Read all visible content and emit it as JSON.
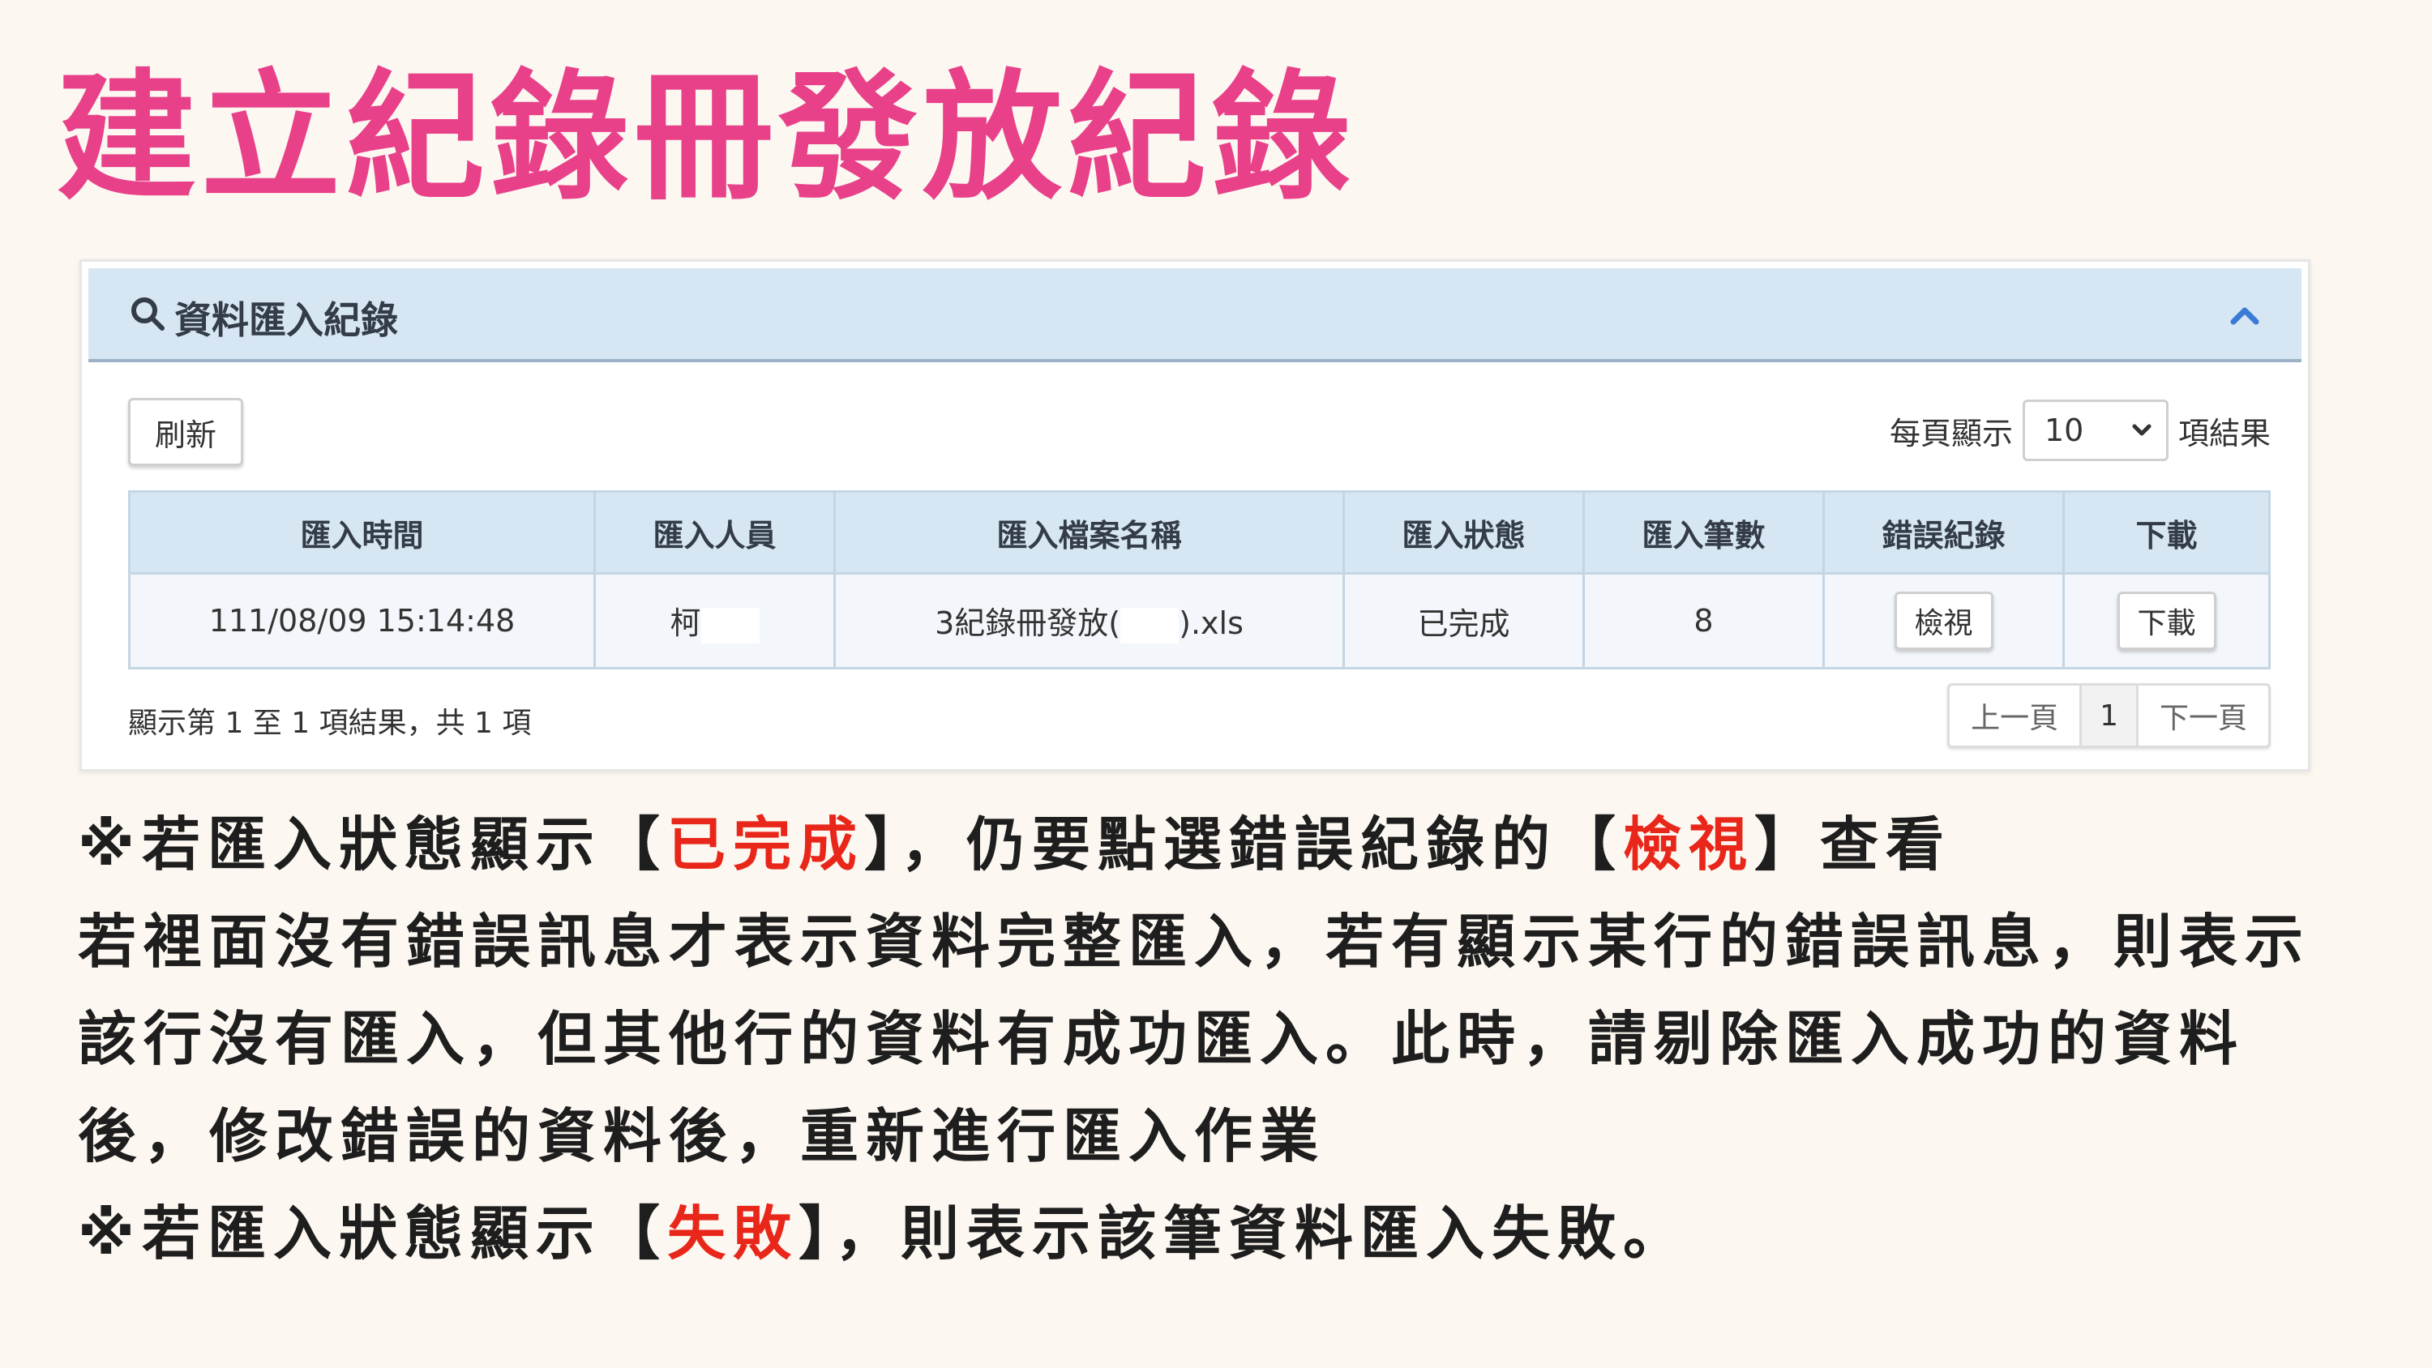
{
  "slide": {
    "title": "建立紀錄冊發放紀錄"
  },
  "panel": {
    "title": "資料匯入紀錄",
    "refresh_label": "刷新",
    "per_page": {
      "prefix": "每頁顯示",
      "value": "10",
      "suffix": "項結果"
    },
    "columns": [
      "匯入時間",
      "匯入人員",
      "匯入檔案名稱",
      "匯入狀態",
      "匯入筆數",
      "錯誤紀錄",
      "下載"
    ],
    "rows": [
      {
        "time": "111/08/09 15:14:48",
        "user": "柯",
        "file_prefix": "3紀錄冊發放(",
        "file_suffix": ").xls",
        "status": "已完成",
        "count": "8",
        "error_btn": "檢視",
        "download_btn": "下載"
      }
    ],
    "info": "顯示第 1 至 1 項結果，共 1 項",
    "pagination": {
      "prev": "上一頁",
      "current": "1",
      "next": "下一頁"
    }
  },
  "notes": {
    "l1_a": "※若匯入狀態顯示【",
    "l1_b": "已完成",
    "l1_c": "】，仍要點選錯誤紀錄的【",
    "l1_d": "檢視",
    "l1_e": "】查看",
    "l2": "若裡面沒有錯誤訊息才表示資料完整匯入，若有顯示某行的錯誤訊息，則表示",
    "l3": "該行沒有匯入，但其他行的資料有成功匯入。此時，請剔除匯入成功的資料",
    "l4": "後，修改錯誤的資料後，重新進行匯入作業",
    "l5_a": "※若匯入狀態顯示【",
    "l5_b": "失敗",
    "l5_c": "】，則表示該筆資料匯入失敗。"
  },
  "colors": {
    "title": "#e8418a",
    "header_bg": "#d6e6f3",
    "highlight": "#e8261a"
  },
  "icons": {
    "search": "search-icon",
    "collapse": "chevron-up-icon",
    "select": "chevron-down-icon"
  }
}
